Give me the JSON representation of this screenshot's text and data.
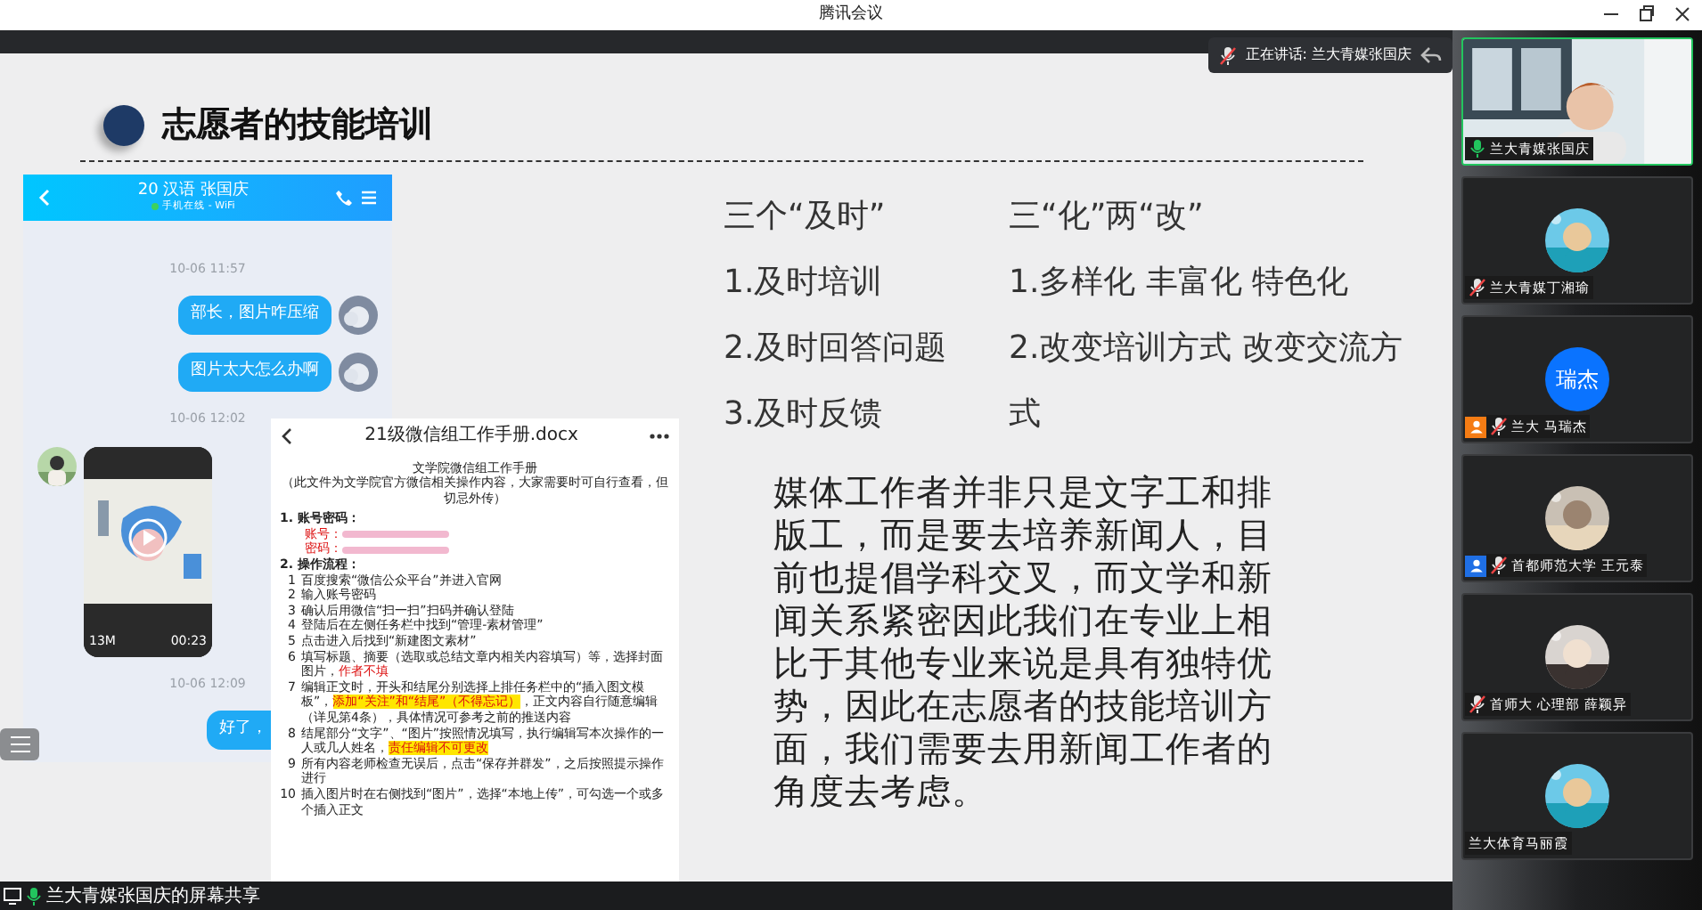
{
  "window": {
    "title": "腾讯会议"
  },
  "speaking": {
    "label": "正在讲话: 兰大青媒张国庆"
  },
  "slide": {
    "title": "志愿者的技能培训",
    "chat": {
      "contact": "20 汉语 张国庆",
      "status": "手机在线 - WiFi",
      "messages": [
        {
          "kind": "time",
          "text": "10-06 11:57"
        },
        {
          "kind": "sent",
          "text": "部长，图片咋压缩"
        },
        {
          "kind": "sent",
          "text": "图片太大怎么办啊"
        },
        {
          "kind": "time",
          "text": "10-06 12:02"
        },
        {
          "kind": "video",
          "size": "13M",
          "duration": "00:23"
        },
        {
          "kind": "time",
          "text": "10-06 12:09"
        },
        {
          "kind": "sent_cut",
          "text": "好了，"
        }
      ]
    },
    "document": {
      "title": "21级微信组工作手册.docx",
      "lines": [
        {
          "kind": "title",
          "parts": [
            {
              "kind": "plain",
              "text": "文学院微信组工作手册"
            }
          ]
        },
        {
          "kind": "note",
          "parts": [
            {
              "kind": "plain",
              "text": "（此文件为文学院官方微信相关操作内容，大家需要时可自行查看，但切忌外传）"
            }
          ]
        },
        {
          "kind": "section",
          "number": "1.",
          "parts": [
            {
              "kind": "plain",
              "text": "账号密码："
            }
          ]
        },
        {
          "kind": "field",
          "parts": [
            {
              "kind": "red",
              "text": "账号："
            }
          ]
        },
        {
          "kind": "field",
          "parts": [
            {
              "kind": "red",
              "text": "密码："
            }
          ]
        },
        {
          "kind": "section",
          "number": "2.",
          "parts": [
            {
              "kind": "plain",
              "text": "操作流程："
            }
          ]
        },
        {
          "kind": "step",
          "number": "1",
          "parts": [
            {
              "kind": "plain",
              "text": "百度搜索“微信公众平台”并进入官网"
            }
          ]
        },
        {
          "kind": "step",
          "number": "2",
          "parts": [
            {
              "kind": "plain",
              "text": "输入账号密码"
            }
          ]
        },
        {
          "kind": "step",
          "number": "3",
          "parts": [
            {
              "kind": "plain",
              "text": "确认后用微信“扫一扫”扫码并确认登陆"
            }
          ]
        },
        {
          "kind": "step",
          "number": "4",
          "parts": [
            {
              "kind": "plain",
              "text": "登陆后在左侧任务栏中找到“管理-素材管理”"
            }
          ]
        },
        {
          "kind": "step",
          "number": "5",
          "parts": [
            {
              "kind": "plain",
              "text": "点击进入后找到“新建图文素材”"
            }
          ]
        },
        {
          "kind": "step",
          "number": "6",
          "parts": [
            {
              "kind": "plain",
              "text": "填写标题、摘要（选取或总结文章内相关内容填写）等，选择封面图片，"
            },
            {
              "kind": "red",
              "text": "作者不填"
            }
          ]
        },
        {
          "kind": "step",
          "number": "7",
          "parts": [
            {
              "kind": "plain",
              "text": "编辑正文时，开头和结尾分别选择上排任务栏中的“插入图文模板”，"
            },
            {
              "kind": "mark",
              "text": "添加“关注”和“结尾”（不得忘记）"
            },
            {
              "kind": "plain",
              "text": "，正文内容自行随意编辑（详见第4条），具体情况可参考之前的推送内容"
            }
          ]
        },
        {
          "kind": "step",
          "number": "8",
          "parts": [
            {
              "kind": "plain",
              "text": "结尾部分“文字”、“图片”按照情况填写，执行编辑写本次操作的一人或几人姓名，"
            },
            {
              "kind": "mark",
              "text": "责任编辑不可更改"
            }
          ]
        },
        {
          "kind": "step",
          "number": "9",
          "parts": [
            {
              "kind": "plain",
              "text": "所有内容老师检查无误后，点击“保存并群发”，之后按照提示操作进行"
            }
          ]
        },
        {
          "kind": "step",
          "number": "10",
          "parts": [
            {
              "kind": "plain",
              "text": "插入图片时在右侧找到“图片”，选择“本地上传”，可勾选一个或多个插入正文"
            }
          ]
        }
      ]
    },
    "columns": [
      {
        "heading": "三个“及时”",
        "items": [
          "1.及时培训",
          "2.及时回答问题",
          "3.及时反馈"
        ]
      },
      {
        "heading": "三“化”两“改”",
        "items": [
          "1.多样化 丰富化 特色化",
          "2.改变培训方式 改变交流方式"
        ]
      }
    ],
    "paragraph": "媒体工作者并非只是文字工和排版工，而是要去培养新闻人，目前也提倡学科交叉，而文学和新闻关系紧密因此我们在专业上相比于其他专业来说是具有独特优势，因此在志愿者的技能培训方面，我们需要去用新闻工作者的角度去考虑。"
  },
  "participants": [
    {
      "name": "兰大青媒张国庆",
      "mic": {
        "muted": false
      },
      "video": true
    },
    {
      "name": "兰大青媒丁湘瑜",
      "mic": {
        "muted": true
      },
      "video": false
    },
    {
      "name": "兰大 马瑞杰",
      "mic": {
        "muted": true
      },
      "video": false,
      "color": "#f57c14",
      "avatar": {
        "kind": "text",
        "text": "瑞杰"
      }
    },
    {
      "name": "首都师范大学 王元泰",
      "mic": {
        "muted": true
      },
      "video": false,
      "color": "#1f6fe5"
    },
    {
      "name": "首师大 心理部 薛颖异",
      "mic": {
        "muted": true
      },
      "video": false
    },
    {
      "name": "兰大体育马丽霞",
      "video": false
    }
  ],
  "status_bar": {
    "label": "兰大青媒张国庆的屏幕共享"
  }
}
